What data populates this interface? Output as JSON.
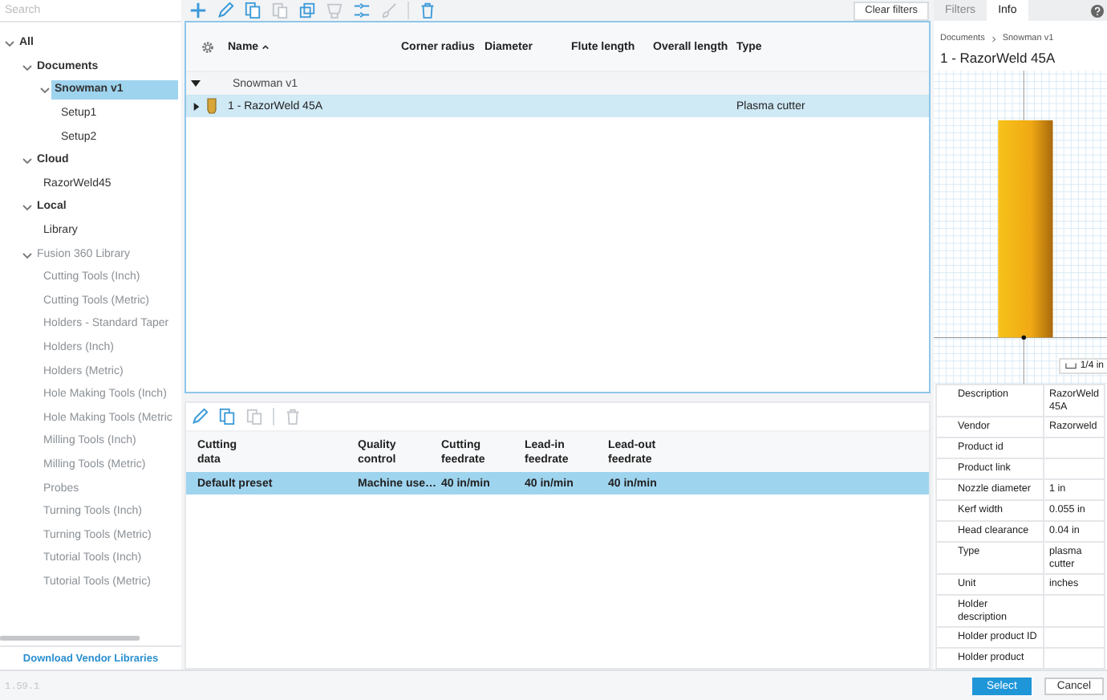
{
  "search": {
    "placeholder": "Search"
  },
  "tree": [
    {
      "label": "All",
      "expanded": true,
      "selected": false,
      "dimmed": false,
      "children": [
        {
          "label": "Documents",
          "expanded": true,
          "selected": false,
          "dimmed": false,
          "children": [
            {
              "label": "Snowman v1",
              "expanded": true,
              "selected": true,
              "dimmed": false,
              "children": [
                {
                  "label": "Setup1",
                  "selected": false,
                  "dimmed": false
                },
                {
                  "label": "Setup2",
                  "selected": false,
                  "dimmed": false
                }
              ]
            }
          ]
        },
        {
          "label": "Cloud",
          "expanded": true,
          "selected": false,
          "dimmed": false,
          "children": [
            {
              "label": "RazorWeld45",
              "selected": false,
              "dimmed": false
            }
          ]
        },
        {
          "label": "Local",
          "expanded": true,
          "selected": false,
          "dimmed": false,
          "children": [
            {
              "label": "Library",
              "selected": false,
              "dimmed": false
            }
          ]
        },
        {
          "label": "Fusion 360 Library",
          "expanded": true,
          "selected": false,
          "dimmed": true,
          "children": [
            {
              "label": "Cutting Tools (Inch)",
              "selected": false,
              "dimmed": true
            },
            {
              "label": "Cutting Tools (Metric)",
              "selected": false,
              "dimmed": true
            },
            {
              "label": "Holders - Standard Taper",
              "selected": false,
              "dimmed": true
            },
            {
              "label": "Holders (Inch)",
              "selected": false,
              "dimmed": true
            },
            {
              "label": "Holders (Metric)",
              "selected": false,
              "dimmed": true
            },
            {
              "label": "Hole Making Tools (Inch)",
              "selected": false,
              "dimmed": true
            },
            {
              "label": "Hole Making Tools (Metric",
              "selected": false,
              "dimmed": true
            },
            {
              "label": "Milling Tools (Inch)",
              "selected": false,
              "dimmed": true
            },
            {
              "label": "Milling Tools (Metric)",
              "selected": false,
              "dimmed": true
            },
            {
              "label": "Probes",
              "selected": false,
              "dimmed": true
            },
            {
              "label": "Turning Tools (Inch)",
              "selected": false,
              "dimmed": true
            },
            {
              "label": "Turning Tools (Metric)",
              "selected": false,
              "dimmed": true
            },
            {
              "label": "Tutorial Tools (Inch)",
              "selected": false,
              "dimmed": true
            },
            {
              "label": "Tutorial Tools (Metric)",
              "selected": false,
              "dimmed": true
            }
          ]
        }
      ]
    }
  ],
  "download_link": "Download Vendor Libraries",
  "version": "1.59.1",
  "toolbar": [
    {
      "kind": "plus",
      "disabled": false
    },
    {
      "kind": "pencil",
      "disabled": false
    },
    {
      "kind": "copy",
      "disabled": false
    },
    {
      "kind": "paste",
      "disabled": true
    },
    {
      "kind": "stack",
      "disabled": false
    },
    {
      "kind": "cup",
      "disabled": true
    },
    {
      "kind": "renumber",
      "disabled": false
    },
    {
      "kind": "brush",
      "disabled": true
    },
    {
      "kind": "separator"
    },
    {
      "kind": "trash",
      "disabled": false
    }
  ],
  "clear_filters": "Clear filters",
  "tools_table": {
    "columns": [
      "Name",
      "Corner radius",
      "Diameter",
      "Flute length",
      "Overall length",
      "Type"
    ],
    "groups": [
      {
        "label": "Snowman v1",
        "expanded": true,
        "rows": [
          {
            "cells": [
              "1 - RazorWeld 45A",
              "",
              "",
              "",
              "",
              "Plasma cutter"
            ],
            "expanded": false,
            "selected": true
          }
        ]
      }
    ]
  },
  "presets": {
    "toolbar": [
      {
        "kind": "pencil",
        "disabled": false
      },
      {
        "kind": "copy",
        "disabled": false
      },
      {
        "kind": "paste",
        "disabled": true
      },
      {
        "kind": "separator"
      },
      {
        "kind": "trash",
        "disabled": true
      }
    ],
    "columns": [
      "Cutting data",
      "Quality control",
      "Cutting feedrate",
      "Lead-in feedrate",
      "Lead-out feedrate"
    ],
    "rows": [
      {
        "cells": [
          "Default preset",
          "Machine use…",
          "40 in/min",
          "40 in/min",
          "40 in/min"
        ],
        "selected": true
      }
    ]
  },
  "info": {
    "tabs": [
      {
        "label": "Filters",
        "selected": false
      },
      {
        "label": "Info",
        "selected": true
      }
    ],
    "breadcrumb": [
      "Documents",
      "Snowman v1"
    ],
    "title": "1 - RazorWeld 45A",
    "scale_label": "1/4 in",
    "properties": [
      {
        "name": "Description",
        "value": "RazorWeld 45A"
      },
      {
        "name": "Vendor",
        "value": "Razorweld"
      },
      {
        "name": "Product id"
      },
      {
        "name": "Product link"
      },
      {
        "name": "Nozzle diameter",
        "value": "1 in"
      },
      {
        "name": "Kerf width",
        "value": "0.055 in"
      },
      {
        "name": "Head clearance",
        "value": "0.04 in"
      },
      {
        "name": "Type",
        "value": "plasma cutter"
      },
      {
        "name": "Unit",
        "value": "inches"
      },
      {
        "name": "Holder description"
      },
      {
        "name": "Holder product ID"
      },
      {
        "name": "Holder product"
      }
    ]
  },
  "buttons": [
    {
      "label": "Select",
      "kind": "primary"
    },
    {
      "label": "Cancel",
      "kind": "secondary"
    }
  ]
}
